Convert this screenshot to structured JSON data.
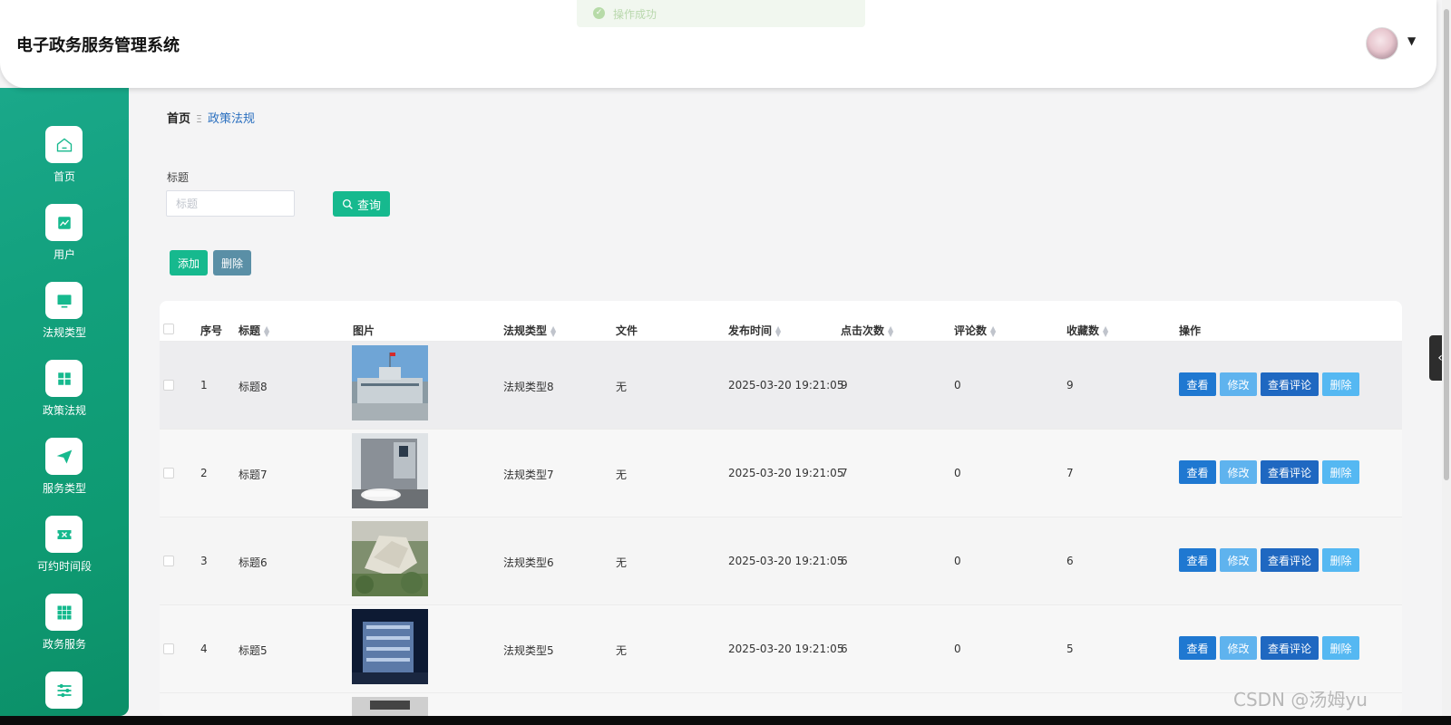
{
  "app": {
    "title": "电子政务服务管理系统"
  },
  "toast": {
    "text": "操作成功"
  },
  "sidebar": {
    "items": [
      {
        "label": "首页",
        "icon": "home-icon"
      },
      {
        "label": "用户",
        "icon": "chart-icon"
      },
      {
        "label": "法规类型",
        "icon": "monitor-icon"
      },
      {
        "label": "政策法规",
        "icon": "grid-icon"
      },
      {
        "label": "服务类型",
        "icon": "send-icon"
      },
      {
        "label": "可约时间段",
        "icon": "ticket-icon"
      },
      {
        "label": "政务服务",
        "icon": "apps-icon"
      },
      {
        "label": "",
        "icon": "sliders-icon"
      }
    ]
  },
  "breadcrumb": {
    "home": "首页",
    "separator": "Ξ",
    "current": "政策法规"
  },
  "search": {
    "label": "标题",
    "placeholder": "标题",
    "query_label": "查询"
  },
  "toolbar": {
    "add_label": "添加",
    "delete_label": "删除"
  },
  "table": {
    "headers": {
      "index": "序号",
      "title": "标题",
      "image": "图片",
      "type": "法规类型",
      "file": "文件",
      "time": "发布时间",
      "clicks": "点击次数",
      "comments": "评论数",
      "favorites": "收藏数",
      "actions": "操作"
    },
    "actions": {
      "view": "查看",
      "edit": "修改",
      "comment": "查看评论",
      "delete": "删除"
    },
    "rows": [
      {
        "index": "1",
        "title": "标题8",
        "type": "法规类型8",
        "file": "无",
        "time": "2025-03-20 19:21:05",
        "clicks": "9",
        "comments": "0",
        "favorites": "9"
      },
      {
        "index": "2",
        "title": "标题7",
        "type": "法规类型7",
        "file": "无",
        "time": "2025-03-20 19:21:05",
        "clicks": "7",
        "comments": "0",
        "favorites": "7"
      },
      {
        "index": "3",
        "title": "标题6",
        "type": "法规类型6",
        "file": "无",
        "time": "2025-03-20 19:21:05",
        "clicks": "6",
        "comments": "0",
        "favorites": "6"
      },
      {
        "index": "4",
        "title": "标题5",
        "type": "法规类型5",
        "file": "无",
        "time": "2025-03-20 19:21:05",
        "clicks": "6",
        "comments": "0",
        "favorites": "5"
      }
    ]
  },
  "watermark": "CSDN @汤姆yu",
  "colors": {
    "accent": "#16b98e",
    "sidebar": "#12a07c",
    "primary_blue": "#1f78d1"
  }
}
